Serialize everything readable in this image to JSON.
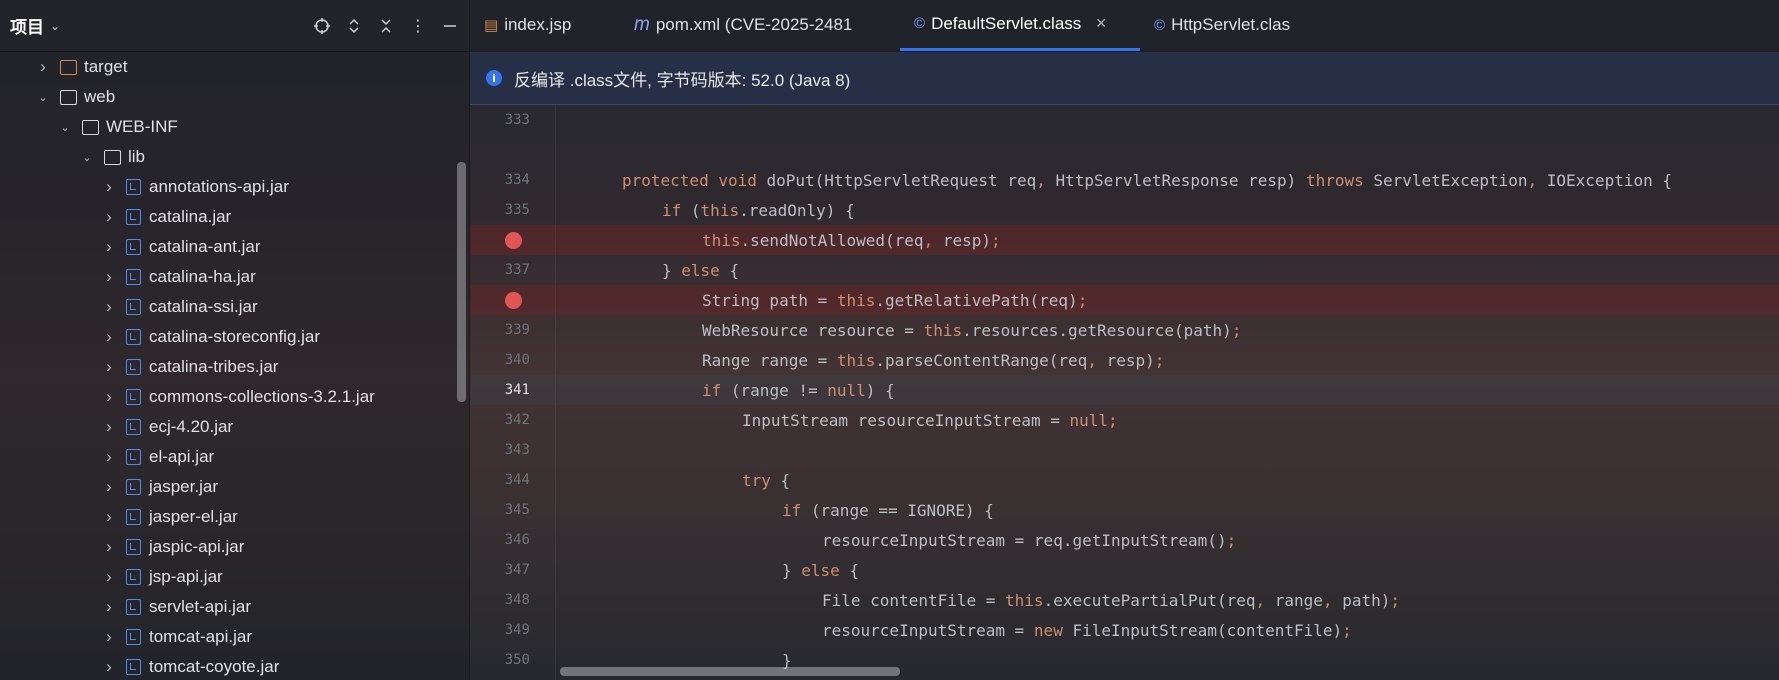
{
  "project": {
    "title": "项目",
    "tree": [
      {
        "label": "target",
        "kind": "folder-orange",
        "depth": 1,
        "expanded": false
      },
      {
        "label": "web",
        "kind": "folder-web",
        "depth": 1,
        "expanded": true
      },
      {
        "label": "WEB-INF",
        "kind": "folder",
        "depth": 2,
        "expanded": true
      },
      {
        "label": "lib",
        "kind": "folder",
        "depth": 3,
        "expanded": true
      },
      {
        "label": "annotations-api.jar",
        "kind": "jar",
        "depth": 4
      },
      {
        "label": "catalina.jar",
        "kind": "jar",
        "depth": 4
      },
      {
        "label": "catalina-ant.jar",
        "kind": "jar",
        "depth": 4
      },
      {
        "label": "catalina-ha.jar",
        "kind": "jar",
        "depth": 4
      },
      {
        "label": "catalina-ssi.jar",
        "kind": "jar",
        "depth": 4
      },
      {
        "label": "catalina-storeconfig.jar",
        "kind": "jar",
        "depth": 4
      },
      {
        "label": "catalina-tribes.jar",
        "kind": "jar",
        "depth": 4
      },
      {
        "label": "commons-collections-3.2.1.jar",
        "kind": "jar",
        "depth": 4
      },
      {
        "label": "ecj-4.20.jar",
        "kind": "jar",
        "depth": 4
      },
      {
        "label": "el-api.jar",
        "kind": "jar",
        "depth": 4
      },
      {
        "label": "jasper.jar",
        "kind": "jar",
        "depth": 4
      },
      {
        "label": "jasper-el.jar",
        "kind": "jar",
        "depth": 4
      },
      {
        "label": "jaspic-api.jar",
        "kind": "jar",
        "depth": 4
      },
      {
        "label": "jsp-api.jar",
        "kind": "jar",
        "depth": 4
      },
      {
        "label": "servlet-api.jar",
        "kind": "jar",
        "depth": 4
      },
      {
        "label": "tomcat-api.jar",
        "kind": "jar",
        "depth": 4
      },
      {
        "label": "tomcat-coyote.jar",
        "kind": "jar",
        "depth": 4
      }
    ]
  },
  "tabs": [
    {
      "label": "index.jsp",
      "icon": "jsp-file-icon",
      "active": false
    },
    {
      "label": "pom.xml (CVE-2025-2481",
      "icon": "maven-icon",
      "active": false
    },
    {
      "label": "DefaultServlet.class",
      "icon": "class-icon",
      "active": true,
      "closable": true
    },
    {
      "label": "HttpServlet.clas",
      "icon": "class-icon",
      "active": false
    }
  ],
  "banner": {
    "text": "反编译 .class文件, 字节码版本: 52.0 (Java 8)"
  },
  "colors": {
    "accent": "#3574f0",
    "keyword": "#cf8e6d",
    "breakpoint": "#e05555"
  },
  "code": [
    {
      "n": "333",
      "tokens": []
    },
    {
      "n": "",
      "tokens": []
    },
    {
      "n": "334",
      "tokens": [
        [
          "kw",
          "protected void "
        ],
        [
          "t",
          "doPut(HttpServletRequest req"
        ],
        [
          "kw",
          ", "
        ],
        [
          "t",
          "HttpServletResponse resp) "
        ],
        [
          "kw",
          "throws "
        ],
        [
          "t",
          "ServletException"
        ],
        [
          "kw",
          ", "
        ],
        [
          "t",
          "IOException {"
        ]
      ],
      "indent": 4
    },
    {
      "n": "335",
      "tokens": [
        [
          "kw",
          "if "
        ],
        [
          "t",
          "("
        ],
        [
          "kw",
          "this"
        ],
        [
          "t",
          ".readOnly) {"
        ]
      ],
      "indent": 8
    },
    {
      "n": "",
      "bp": true,
      "tokens": [
        [
          "kw",
          "this"
        ],
        [
          "t",
          ".sendNotAllowed(req"
        ],
        [
          "kw",
          ", "
        ],
        [
          "t",
          "resp)"
        ],
        [
          "kw",
          ";"
        ]
      ],
      "indent": 12
    },
    {
      "n": "337",
      "tokens": [
        [
          "t",
          "} "
        ],
        [
          "kw",
          "else "
        ],
        [
          "t",
          "{"
        ]
      ],
      "indent": 8
    },
    {
      "n": "",
      "bp": true,
      "tokens": [
        [
          "t",
          "String path = "
        ],
        [
          "kw",
          "this"
        ],
        [
          "t",
          ".getRelativePath(req)"
        ],
        [
          "kw",
          ";"
        ]
      ],
      "indent": 12
    },
    {
      "n": "339",
      "tokens": [
        [
          "t",
          "WebResource resource = "
        ],
        [
          "kw",
          "this"
        ],
        [
          "t",
          ".resources.getResource(path)"
        ],
        [
          "kw",
          ";"
        ]
      ],
      "indent": 12
    },
    {
      "n": "340",
      "tokens": [
        [
          "t",
          "Range range = "
        ],
        [
          "kw",
          "this"
        ],
        [
          "t",
          ".parseContentRange(req"
        ],
        [
          "kw",
          ", "
        ],
        [
          "t",
          "resp)"
        ],
        [
          "kw",
          ";"
        ]
      ],
      "indent": 12
    },
    {
      "n": "341",
      "cur": true,
      "tokens": [
        [
          "kw",
          "if "
        ],
        [
          "t",
          "(range != "
        ],
        [
          "kw",
          "null"
        ],
        [
          "t",
          ") {"
        ]
      ],
      "indent": 12
    },
    {
      "n": "342",
      "tokens": [
        [
          "t",
          "InputStream resourceInputStream = "
        ],
        [
          "kw",
          "null"
        ],
        [
          "kw",
          ";"
        ]
      ],
      "indent": 16
    },
    {
      "n": "343",
      "tokens": []
    },
    {
      "n": "344",
      "tokens": [
        [
          "kw",
          "try "
        ],
        [
          "t",
          "{"
        ]
      ],
      "indent": 16
    },
    {
      "n": "345",
      "tokens": [
        [
          "kw",
          "if "
        ],
        [
          "t",
          "(range == IGNORE) {"
        ]
      ],
      "indent": 20
    },
    {
      "n": "346",
      "tokens": [
        [
          "t",
          "resourceInputStream = req.getInputStream()"
        ],
        [
          "kw",
          ";"
        ]
      ],
      "indent": 24
    },
    {
      "n": "347",
      "tokens": [
        [
          "t",
          "} "
        ],
        [
          "kw",
          "else "
        ],
        [
          "t",
          "{"
        ]
      ],
      "indent": 20
    },
    {
      "n": "348",
      "tokens": [
        [
          "t",
          "File contentFile = "
        ],
        [
          "kw",
          "this"
        ],
        [
          "t",
          ".executePartialPut(req"
        ],
        [
          "kw",
          ", "
        ],
        [
          "t",
          "range"
        ],
        [
          "kw",
          ", "
        ],
        [
          "t",
          "path)"
        ],
        [
          "kw",
          ";"
        ]
      ],
      "indent": 24
    },
    {
      "n": "349",
      "tokens": [
        [
          "t",
          "resourceInputStream = "
        ],
        [
          "kw",
          "new "
        ],
        [
          "t",
          "FileInputStream(contentFile)"
        ],
        [
          "kw",
          ";"
        ]
      ],
      "indent": 24
    },
    {
      "n": "350",
      "tokens": [
        [
          "t",
          "}"
        ]
      ],
      "indent": 20
    }
  ]
}
